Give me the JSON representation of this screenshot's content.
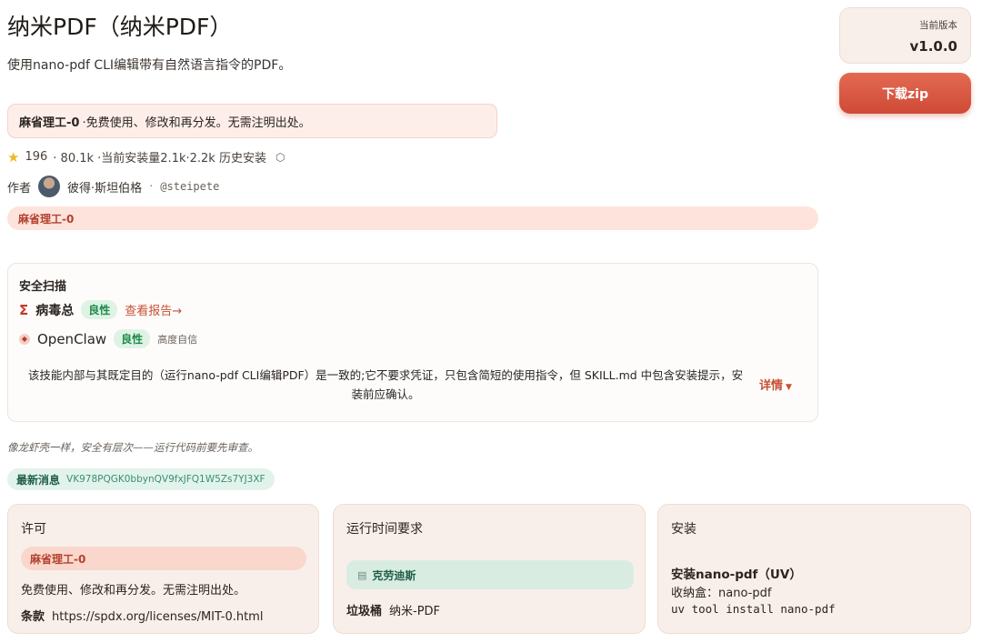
{
  "header": {
    "title": "纳米PDF（纳米PDF）",
    "subtitle": "使用nano-pdf CLI编辑带有自然语言指令的PDF。"
  },
  "license_notice": {
    "name": "麻省理工-0",
    "text": "·免费使用、修改和再分发。无需注明出处。"
  },
  "stats": {
    "stars": "196",
    "text": "· 80.1k ·当前安装量2.1k·2.2k 历史安装"
  },
  "author": {
    "label": "作者",
    "name": "彼得·斯坦伯格",
    "separator": "·",
    "handle": "@steipete"
  },
  "license_tag": "麻省理工-0",
  "security": {
    "title": "安全扫描",
    "virustotal": {
      "name": "病毒总",
      "status": "良性",
      "link": "查看报告→"
    },
    "openclaw": {
      "name": "OpenClaw",
      "status": "良性",
      "confidence": "高度自信"
    },
    "summary": "该技能内部与其既定目的（运行nano-pdf CLI编辑PDF）是一致的;它不要求凭证，只包含简短的使用指令，但 SKILL.md 中包含安装提示，安装前应确认。",
    "details_label": "详情"
  },
  "tagline": "像龙虾壳一样，安全有层次——运行代码前要先审查。",
  "latest_news": {
    "label": "最新消息",
    "id": "VK978PQGK0bbynQV9fxJFQ1W5Zs7YJ3XF"
  },
  "license_card": {
    "title": "许可",
    "tag": "麻省理工-0",
    "description": "免费使用、修改和再分发。无需注明出处。",
    "terms_label": "条款",
    "terms_url": "https://spdx.org/licenses/MIT-0.html"
  },
  "runtime_card": {
    "title": "运行时间要求",
    "requirement": "克劳迪斯",
    "bin_label": "垃圾桶",
    "bin_value": "纳米-PDF"
  },
  "install_card": {
    "title": "安装",
    "method_title": "安装nano-pdf（UV）",
    "package_line": "收纳盒：nano-pdf",
    "command": "uv tool install nano-pdf"
  },
  "version": {
    "label": "当前版本",
    "value": "v1.0.0"
  },
  "download_label": "下载zip",
  "colors": {
    "accent": "#cf4a36",
    "benign": "#1d8a4a",
    "license_tag": "#b3412e"
  }
}
